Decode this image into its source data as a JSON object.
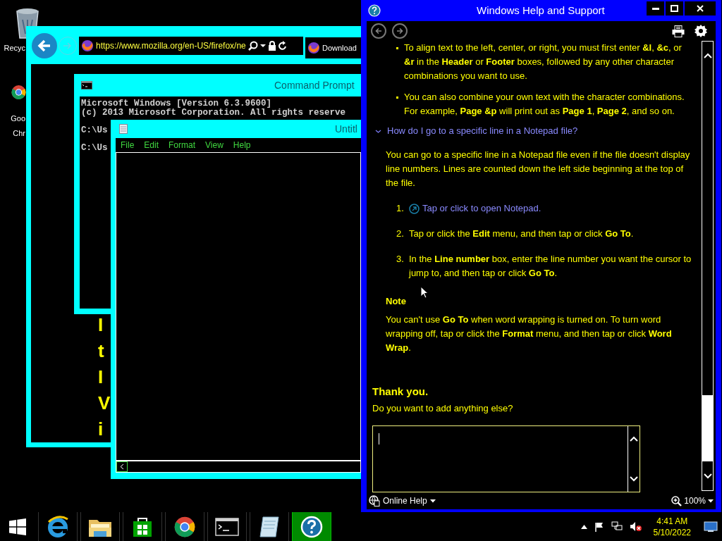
{
  "desktop_icons": [
    {
      "kind": "recycle",
      "lines": [
        "Recyc"
      ]
    },
    {
      "kind": "chrome",
      "lines": [
        "Goo",
        "Chr"
      ]
    }
  ],
  "browser": {
    "url": "https://www.mozilla.org/en-US/firefox/ne",
    "tab": "Download",
    "page_fragments": [
      "I",
      "t",
      "I",
      "V",
      "i"
    ]
  },
  "command_prompt": {
    "title": "Command Prompt",
    "lines": [
      "Microsoft Windows [Version 6.3.9600]",
      "(c) 2013 Microsoft Corporation. All rights reserve",
      "C:\\Us",
      "C:\\Us"
    ]
  },
  "notepad": {
    "title": "Untitl",
    "menu": [
      "File",
      "Edit",
      "Format",
      "View",
      "Help"
    ]
  },
  "help": {
    "title": "Windows Help and Support",
    "bullets": [
      "To align text to the left, center, or right, you must first enter **&l**, **&c**, or **&r** in the **Header** or **Footer** boxes, followed by any other character combinations you want to use.",
      "You can also combine your own text with the character combinations. For example, **Page &p** will print out as **Page 1**, **Page 2**, and so on."
    ],
    "question": {
      "text": "How do I go to a specific line in a Notepad file?",
      "expanded": true
    },
    "intro": "You can go to a specific line in a Notepad file even if the file doesn't display line numbers. Lines are counted down the left side beginning at the top of the file.",
    "steps": [
      {
        "number": "1.",
        "kind": "link",
        "text": "Tap or click to open Notepad."
      },
      {
        "number": "2.",
        "kind": "text",
        "text": "Tap or click the **Edit** menu, and then tap or click **Go To**."
      },
      {
        "number": "3.",
        "kind": "text",
        "text": "In the **Line number** box, enter the line number you want the cursor to jump to, and then tap or click **Go To**."
      }
    ],
    "note_heading": "Note",
    "note": "You can't use **Go To** when word wrapping is turned on. To turn word wrapping off, tap or click the **Format** menu, and then tap or click **Word Wrap**.",
    "thanks": "Thank you.",
    "prompt": "Do you want to add anything else?",
    "online_help": "Online Help",
    "zoom": "100%"
  },
  "taskbar": {
    "apps": [
      {
        "kind": "ie",
        "selected": false
      },
      {
        "kind": "explorer",
        "selected": false
      },
      {
        "kind": "store",
        "selected": false
      },
      {
        "kind": "chrome",
        "selected": false
      },
      {
        "kind": "cmd",
        "selected": false
      },
      {
        "kind": "notepad",
        "selected": false
      },
      {
        "kind": "help",
        "selected": true
      }
    ],
    "time": "4:41 AM",
    "date": "5/10/2022"
  }
}
